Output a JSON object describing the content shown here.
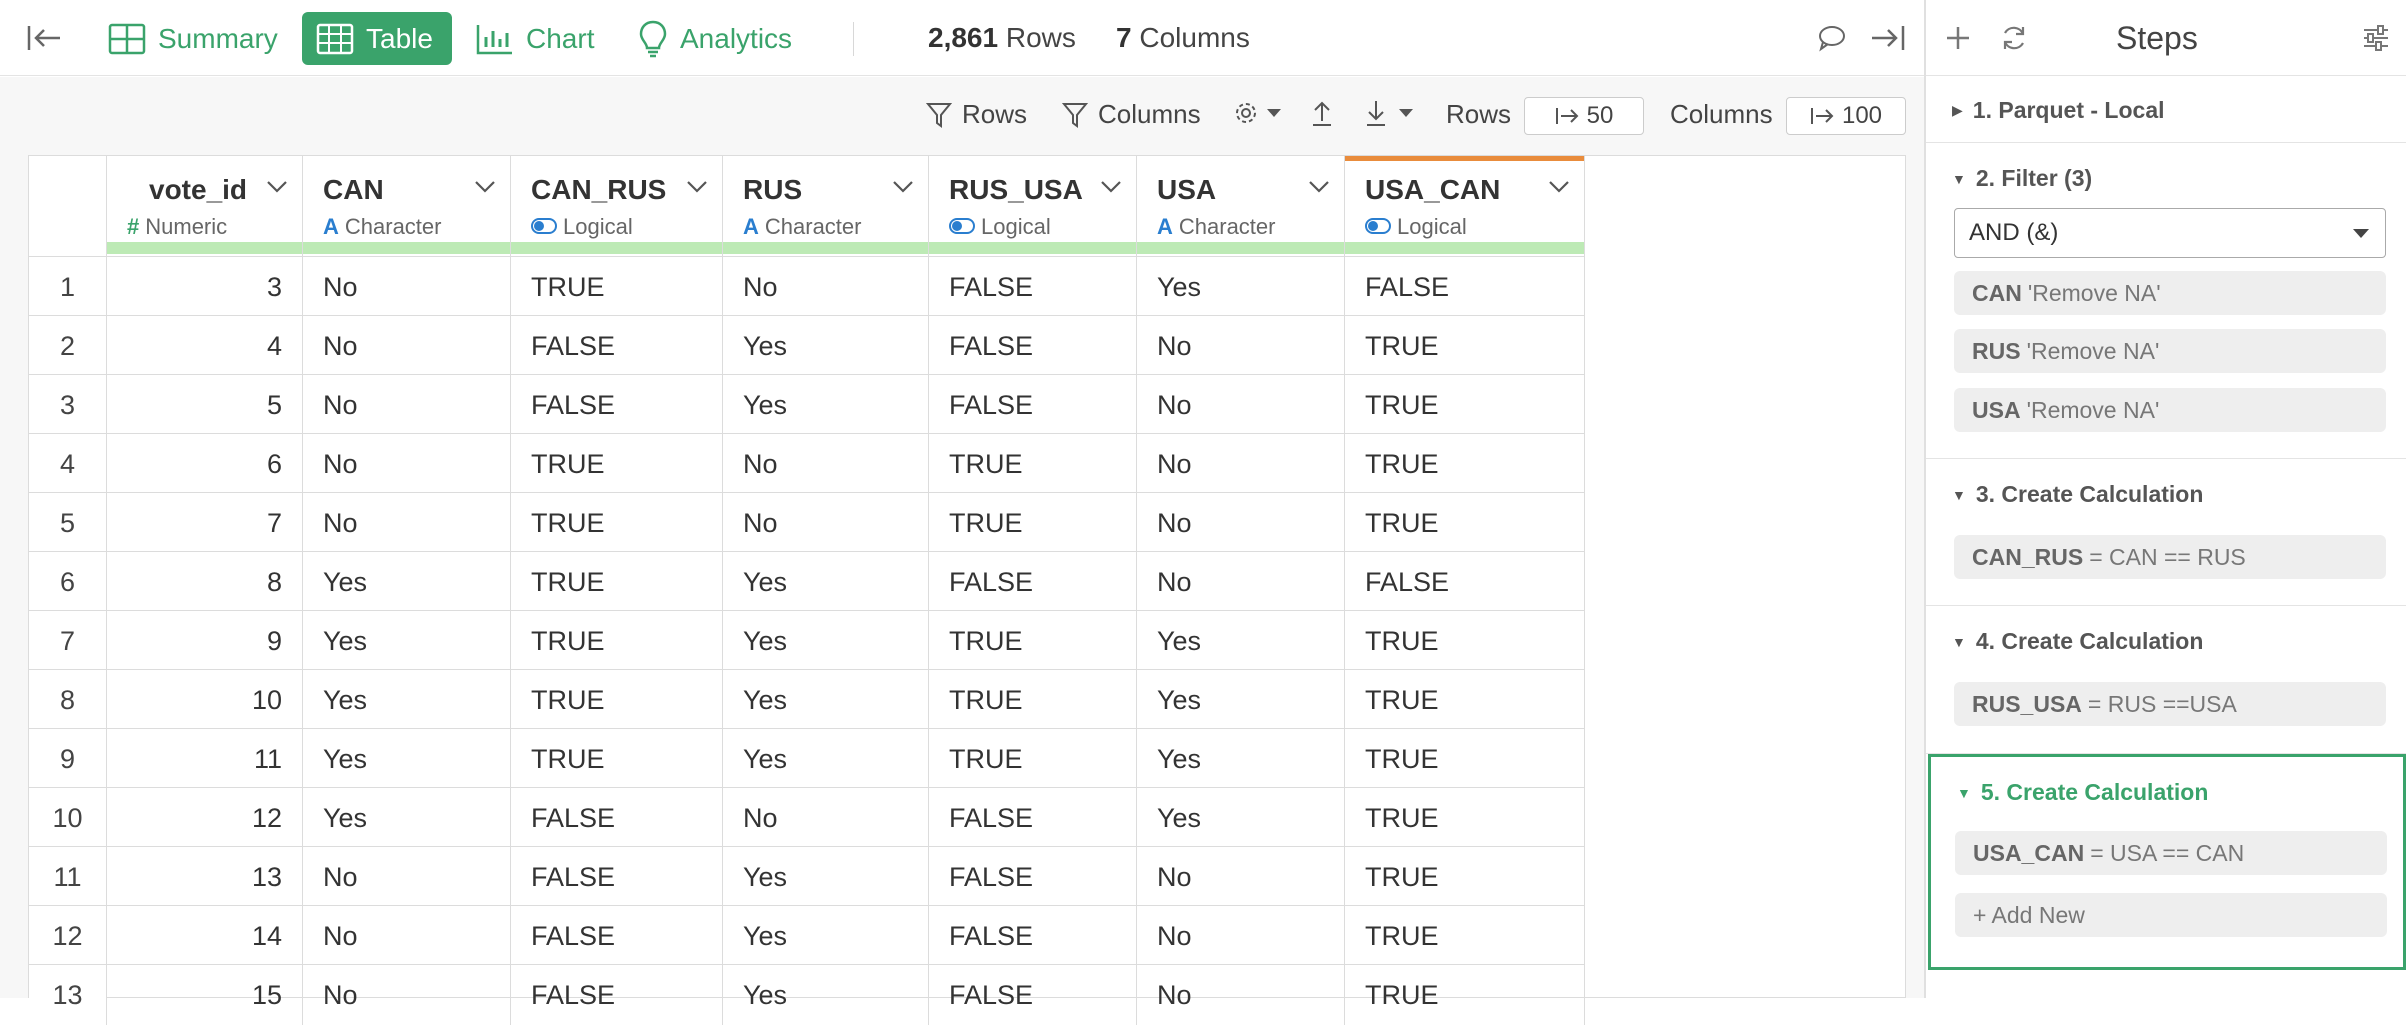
{
  "topbar": {
    "tabs": [
      {
        "label": "Summary",
        "icon": "summary-grid-icon"
      },
      {
        "label": "Table",
        "icon": "table-icon"
      },
      {
        "label": "Chart",
        "icon": "bar-chart-icon"
      },
      {
        "label": "Analytics",
        "icon": "lightbulb-icon"
      }
    ],
    "active_tab": "Table",
    "row_count": "2,861",
    "rows_label": "Rows",
    "col_count": "7",
    "cols_label": "Columns"
  },
  "toolbar": {
    "rows_filter_label": "Rows",
    "columns_filter_label": "Columns",
    "rows_label": "Rows",
    "rows_value": "50",
    "columns_label": "Columns",
    "columns_value": "100"
  },
  "table": {
    "columns": [
      {
        "name": "vote_id",
        "type": "Numeric",
        "type_symbol": "#",
        "type_color": "#3aa36b"
      },
      {
        "name": "CAN",
        "type": "Character",
        "type_symbol": "A",
        "type_color": "#2a7ecf"
      },
      {
        "name": "CAN_RUS",
        "type": "Logical",
        "type_symbol": "toggle",
        "type_color": "#2a7ecf"
      },
      {
        "name": "RUS",
        "type": "Character",
        "type_symbol": "A",
        "type_color": "#2a7ecf"
      },
      {
        "name": "RUS_USA",
        "type": "Logical",
        "type_symbol": "toggle",
        "type_color": "#2a7ecf"
      },
      {
        "name": "USA",
        "type": "Character",
        "type_symbol": "A",
        "type_color": "#2a7ecf"
      },
      {
        "name": "USA_CAN",
        "type": "Logical",
        "type_symbol": "toggle",
        "type_color": "#2a7ecf"
      }
    ],
    "rows": [
      [
        "1",
        "3",
        "No",
        "TRUE",
        "No",
        "FALSE",
        "Yes",
        "FALSE"
      ],
      [
        "2",
        "4",
        "No",
        "FALSE",
        "Yes",
        "FALSE",
        "No",
        "TRUE"
      ],
      [
        "3",
        "5",
        "No",
        "FALSE",
        "Yes",
        "FALSE",
        "No",
        "TRUE"
      ],
      [
        "4",
        "6",
        "No",
        "TRUE",
        "No",
        "TRUE",
        "No",
        "TRUE"
      ],
      [
        "5",
        "7",
        "No",
        "TRUE",
        "No",
        "TRUE",
        "No",
        "TRUE"
      ],
      [
        "6",
        "8",
        "Yes",
        "TRUE",
        "Yes",
        "FALSE",
        "No",
        "FALSE"
      ],
      [
        "7",
        "9",
        "Yes",
        "TRUE",
        "Yes",
        "TRUE",
        "Yes",
        "TRUE"
      ],
      [
        "8",
        "10",
        "Yes",
        "TRUE",
        "Yes",
        "TRUE",
        "Yes",
        "TRUE"
      ],
      [
        "9",
        "11",
        "Yes",
        "TRUE",
        "Yes",
        "TRUE",
        "Yes",
        "TRUE"
      ],
      [
        "10",
        "12",
        "Yes",
        "FALSE",
        "No",
        "FALSE",
        "Yes",
        "TRUE"
      ],
      [
        "11",
        "13",
        "No",
        "FALSE",
        "Yes",
        "FALSE",
        "No",
        "TRUE"
      ],
      [
        "12",
        "14",
        "No",
        "FALSE",
        "Yes",
        "FALSE",
        "No",
        "TRUE"
      ],
      [
        "13",
        "15",
        "No",
        "FALSE",
        "Yes",
        "FALSE",
        "No",
        "TRUE"
      ]
    ]
  },
  "steps_panel": {
    "title": "Steps",
    "steps": [
      {
        "title": "1. Parquet - Local",
        "expanded": false
      },
      {
        "title": "2. Filter (3)",
        "expanded": true,
        "operator": "AND (&)",
        "conditions": [
          {
            "col": "CAN",
            "text": "'Remove NA'"
          },
          {
            "col": "RUS",
            "text": "'Remove NA'"
          },
          {
            "col": "USA",
            "text": "'Remove NA'"
          }
        ]
      },
      {
        "title": "3. Create Calculation",
        "expanded": true,
        "calc": {
          "col": "CAN_RUS",
          "text": "= CAN == RUS"
        }
      },
      {
        "title": "4. Create Calculation",
        "expanded": true,
        "calc": {
          "col": "RUS_USA",
          "text": "= RUS ==USA"
        }
      },
      {
        "title": "5. Create Calculation",
        "expanded": true,
        "active": true,
        "calc": {
          "col": "USA_CAN",
          "text": "= USA == CAN"
        },
        "add_new": "+ Add New"
      }
    ]
  },
  "colors": {
    "accent": "#3aa36b",
    "highlight_bar": "#bdeab5",
    "selected_col": "#e98c3c"
  }
}
